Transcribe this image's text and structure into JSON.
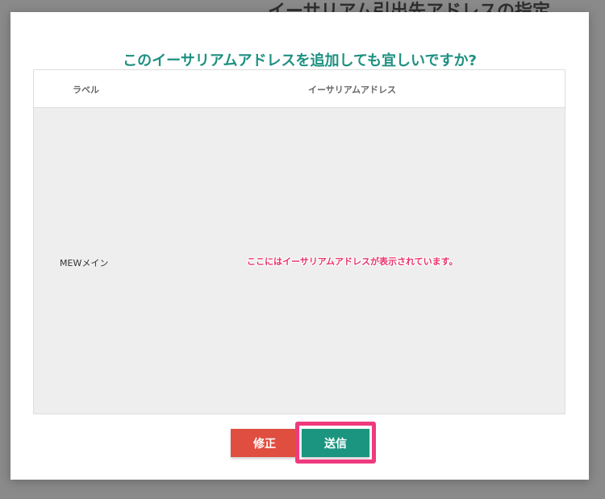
{
  "background": {
    "title": "イーサリアム引出先アドレスの指定"
  },
  "dialog": {
    "title": "このイーサリアムアドレスを追加しても宜しいですか?",
    "table": {
      "columns": [
        "ラベル",
        "イーサリアムアドレス"
      ],
      "rows": [
        {
          "label": "MEWメイン",
          "address": "ここにはイーサリアムアドレスが表示されています。"
        }
      ]
    },
    "buttons": {
      "edit": "修正",
      "submit": "送信"
    }
  },
  "colors": {
    "title": "#1e9081",
    "edit_button": "#e04e40",
    "submit_button": "#1b9580",
    "annotation": "#e8336b",
    "highlight_border": "#f03a7e"
  }
}
